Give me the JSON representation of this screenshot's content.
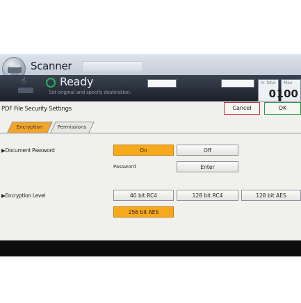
{
  "header": {
    "app_title": "Scanner",
    "status": "Ready",
    "hint": "Set original and specify destination.",
    "counter": {
      "label": "% Total",
      "value": "0"
    },
    "counter2": {
      "label": "Max",
      "value": "100"
    }
  },
  "dialog": {
    "title": "PDF File Security Settings",
    "cancel_label": "Cancel",
    "ok_label": "OK",
    "tabs": [
      {
        "label": "Encryption",
        "selected": true
      },
      {
        "label": "Permissions",
        "selected": false
      }
    ],
    "document_password": {
      "label": "▶Document Password",
      "options": [
        {
          "label": "On",
          "selected": true
        },
        {
          "label": "Off",
          "selected": false
        }
      ],
      "password_label": "Password",
      "enter_label": "Enter"
    },
    "encryption_level": {
      "label": "▶Encryption Level",
      "options": [
        {
          "label": "40 bit RC4",
          "selected": false
        },
        {
          "label": "128 bit RC4",
          "selected": false
        },
        {
          "label": "128 bit AES",
          "selected": false
        },
        {
          "label": "256 bit AES",
          "selected": true
        }
      ]
    }
  },
  "colors": {
    "selected": "#f7a91c",
    "ready": "#27b35a",
    "cancel_border": "#c8323a",
    "ok_border": "#2e9a45"
  }
}
